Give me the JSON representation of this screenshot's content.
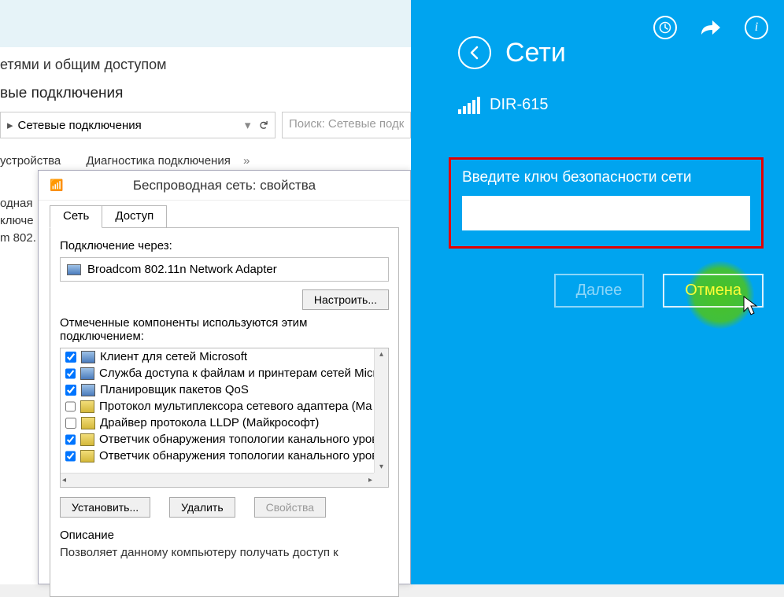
{
  "bg": {
    "title_fragment": "етями и общим доступом",
    "subtitle_fragment": "вые подключения",
    "breadcrumb": "Сетевые подключения",
    "search_placeholder": "Поиск: Сетевые подк",
    "toolbar_item1": "устройства",
    "toolbar_item2": "Диагностика подключения",
    "sidebar_frag1": "одная",
    "sidebar_frag2": "ключе",
    "sidebar_frag3": "m 802."
  },
  "props": {
    "title": "Беспроводная сеть: свойства",
    "tab_network": "Сеть",
    "tab_access": "Доступ",
    "connect_via_label": "Подключение через:",
    "adapter_name": "Broadcom 802.11n Network Adapter",
    "configure_btn": "Настроить...",
    "components_label": "Отмеченные компоненты используются этим подключением:",
    "components": [
      {
        "checked": true,
        "iconClass": "ci-monitor",
        "label": "Клиент для сетей Microsoft"
      },
      {
        "checked": true,
        "iconClass": "ci-monitor",
        "label": "Служба доступа к файлам и принтерам сетей Micro"
      },
      {
        "checked": true,
        "iconClass": "ci-monitor",
        "label": "Планировщик пакетов QoS"
      },
      {
        "checked": false,
        "iconClass": "ci-yellow",
        "label": "Протокол мультиплексора сетевого адаптера (Ма"
      },
      {
        "checked": false,
        "iconClass": "ci-yellow",
        "label": "Драйвер протокола LLDP (Майкрософт)"
      },
      {
        "checked": true,
        "iconClass": "ci-yellow",
        "label": "Ответчик обнаружения топологии канального уров"
      },
      {
        "checked": true,
        "iconClass": "ci-yellow",
        "label": "Ответчик обнаружения топологии канального уров"
      }
    ],
    "install_btn": "Установить...",
    "remove_btn": "Удалить",
    "properties_btn": "Свойства",
    "description_label": "Описание",
    "description_text": "Позволяет данному компьютеру получать доступ к"
  },
  "metro": {
    "title": "Сети",
    "network_name": "DIR-615",
    "key_prompt": "Введите ключ безопасности сети",
    "key_value": "",
    "next_btn": "Далее",
    "cancel_btn": "Отмена"
  }
}
